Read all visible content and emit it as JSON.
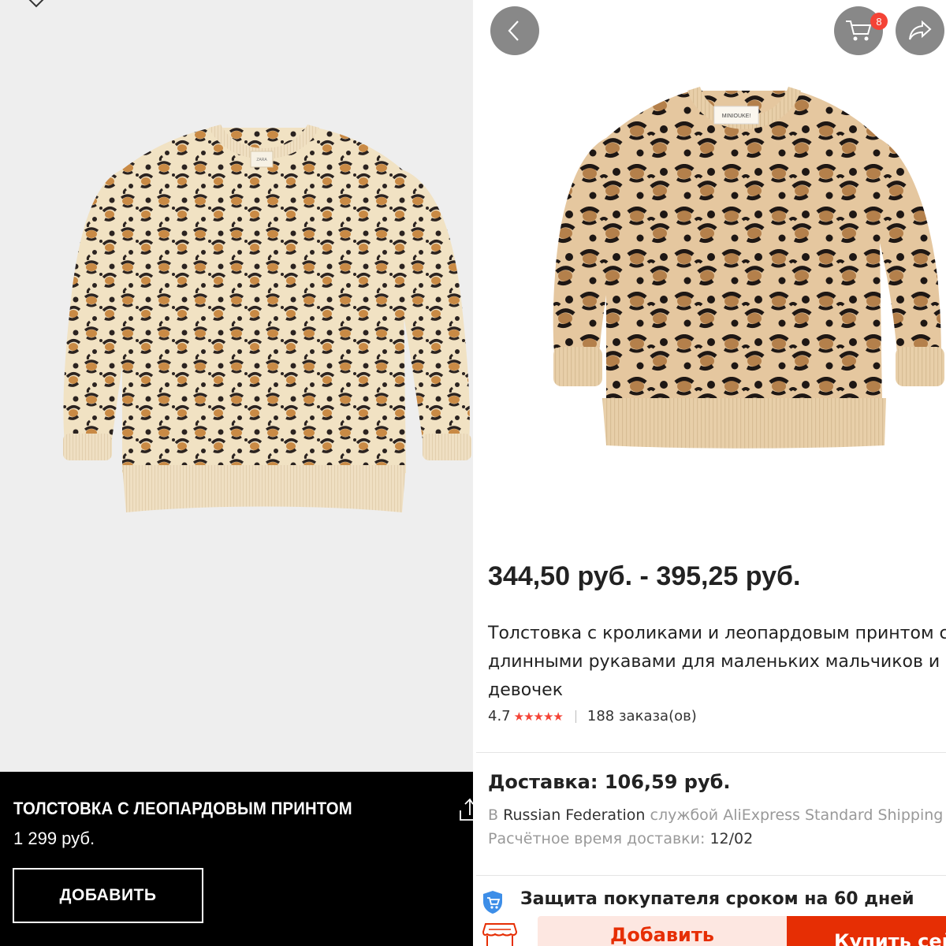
{
  "left_panel": {
    "close_icon": "close-icon",
    "product_title": "ТОЛСТОВКА С ЛЕОПАРДОВЫМ ПРИНТОМ",
    "price": "1 299 руб.",
    "add_button_label": "ДОБАВИТЬ",
    "share_icon": "share-upload-icon",
    "label_tag": "ZARA"
  },
  "right_panel": {
    "back_icon": "chevron-left-icon",
    "cart_icon": "cart-icon",
    "cart_badge": "8",
    "share_icon": "share-arrow-icon",
    "label_tag": "MINIOUKE!",
    "price_range": "344,50 руб. - 395,25 руб.",
    "title_line1": "Толстовка с кроликами и леопардовым принтом с",
    "title_line2": "длинными рукавами для маленьких мальчиков и",
    "title_line3": "девочек",
    "rating": "4.7",
    "stars": "★★★★★",
    "orders": "188 заказа(ов)",
    "delivery": "Доставка: 106,59 руб.",
    "ship_prefix": "В",
    "ship_country": "Russian Federation",
    "ship_service": "службой AliExpress Standard Shipping",
    "eta_label": "Расчётное время доставки:",
    "eta_value": "12/02",
    "protection": "Защита покупателя сроком на 60 дней",
    "add_to_cart": "Добавить",
    "buy_now": "Купить сейчас"
  },
  "colors": {
    "ali_red": "#e62e04",
    "star_red": "#f44336",
    "zara_black": "#000000"
  }
}
